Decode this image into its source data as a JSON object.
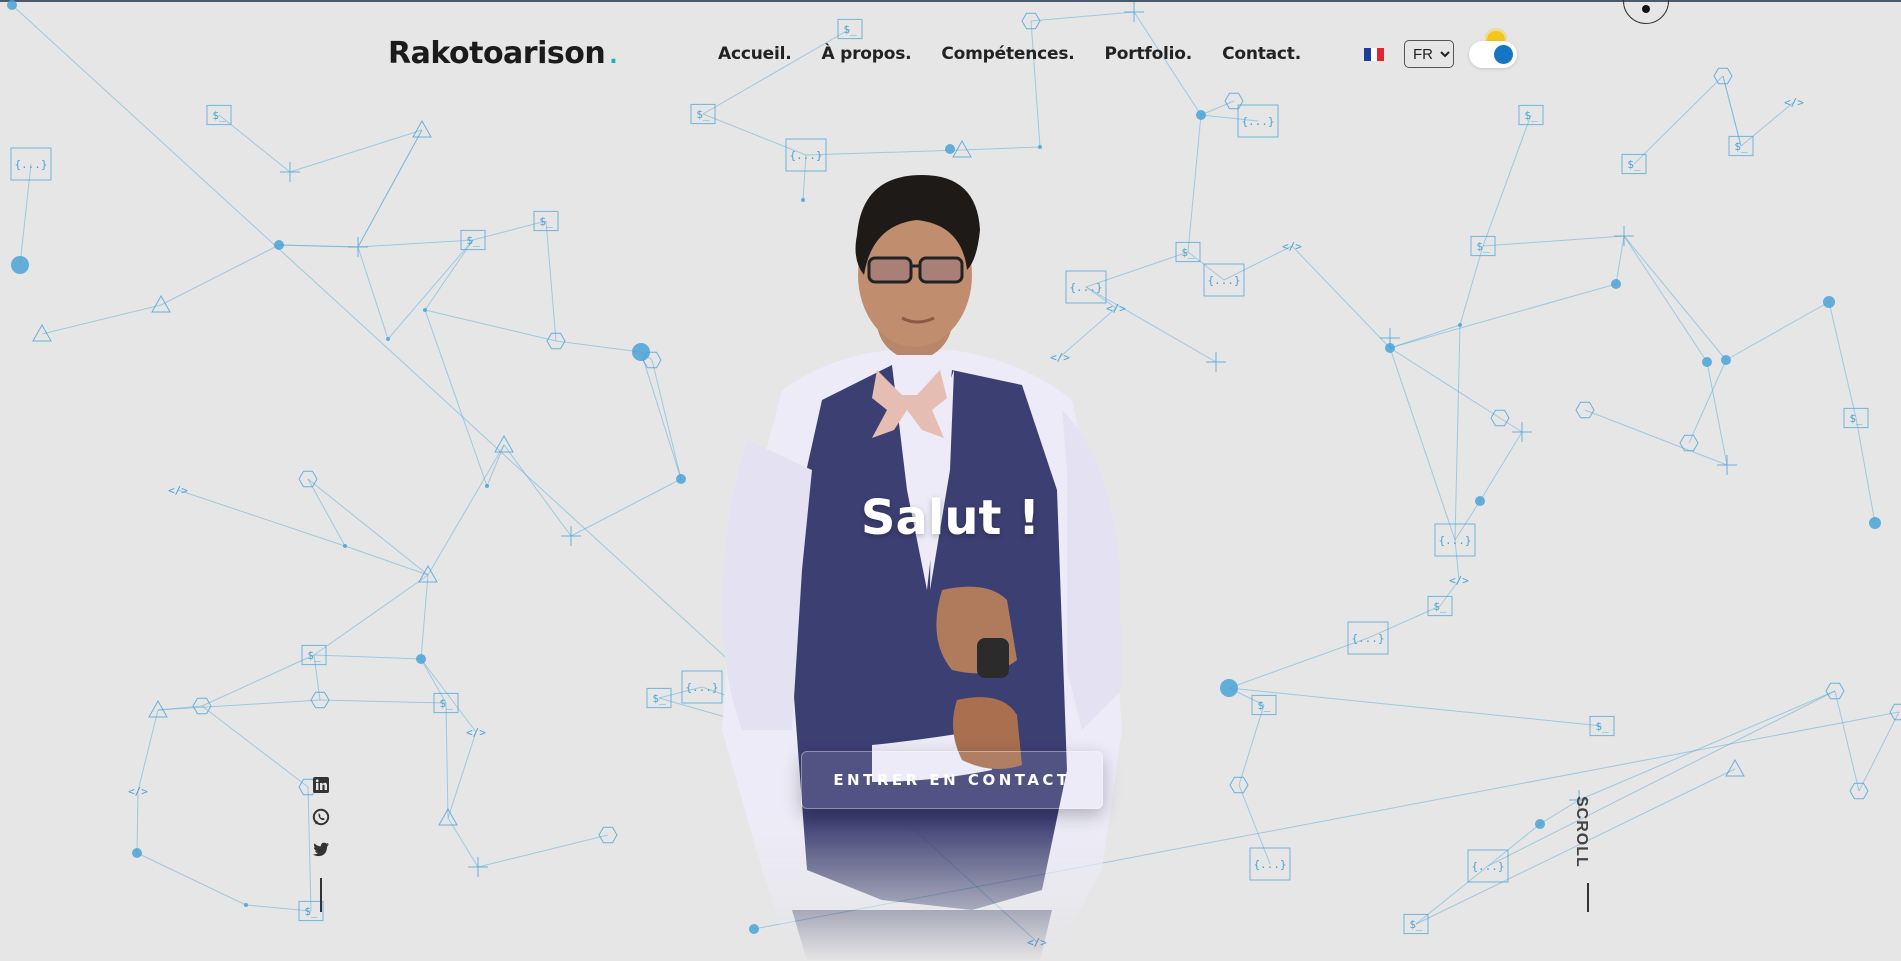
{
  "header": {
    "logo_text": "Rakotoarison",
    "logo_accent": ".",
    "nav": [
      {
        "label": "Accueil."
      },
      {
        "label": "À propos."
      },
      {
        "label": "Compétences."
      },
      {
        "label": "Portfolio."
      },
      {
        "label": "Contact."
      }
    ],
    "language": {
      "selected": "FR",
      "flag": "france-flag-icon"
    },
    "theme_toggle": {
      "state": "dark-mode-off",
      "icon": "sun-icon"
    }
  },
  "hero": {
    "greeting": "Salut !",
    "cta_label": "ENTRER EN CONTACT",
    "photo": "portrait-photo"
  },
  "social": [
    {
      "name": "linkedin-icon"
    },
    {
      "name": "whatsapp-icon"
    },
    {
      "name": "twitter-icon"
    }
  ],
  "scroll_label": "SCROLL",
  "background": {
    "pattern": "network-graph",
    "symbols": [
      "$_",
      "{...}",
      "</>"
    ]
  },
  "colors": {
    "background": "#e6e6e6",
    "network": "#4aa3d6",
    "accent": "#14b5b5",
    "toggle_knob": "#1676c4",
    "vest": "#3c3f72",
    "shirt": "#ecebf7",
    "bowtie": "#e6bdb3"
  }
}
